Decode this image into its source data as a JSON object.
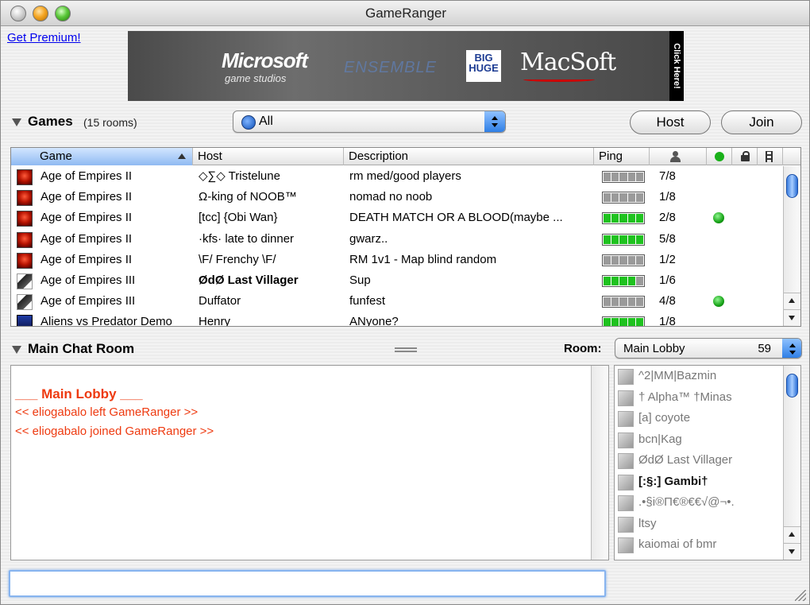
{
  "window": {
    "title": "GameRanger"
  },
  "premium_link": "Get Premium!",
  "banner": {
    "microsoft": "Microsoft",
    "microsoft_sub": "game studios",
    "ensemble": "ENSEMBLE",
    "bighuge": "BIG HUGE",
    "macsoft": "MacSoft",
    "click_here": "Click Here!"
  },
  "games": {
    "label": "Games",
    "count": "(15 rooms)",
    "filter_value": "All",
    "host_label": "Host",
    "join_label": "Join",
    "columns": [
      "Game",
      "Host",
      "Description",
      "Ping"
    ],
    "rows": [
      {
        "icon": "aoe2-icon",
        "game": "Age of Empires II",
        "host": "◇∑◇ Tristelune",
        "host_bold": false,
        "desc": "rm med/good players",
        "ping": 0,
        "players": "7/8",
        "open": false
      },
      {
        "icon": "aoe2-icon",
        "game": "Age of Empires II",
        "host": "Ω-king of NOOB™",
        "host_bold": false,
        "desc": "nomad no noob",
        "ping": 0,
        "players": "1/8",
        "open": false
      },
      {
        "icon": "aoe2-icon",
        "game": "Age of Empires II",
        "host": "[tcc] {Obi Wan}",
        "host_bold": false,
        "desc": "DEATH MATCH OR A BLOOD(maybe ...",
        "ping": 5,
        "players": "2/8",
        "open": true
      },
      {
        "icon": "aoe2-icon",
        "game": "Age of Empires II",
        "host": "·kfs· late to dinner",
        "host_bold": false,
        "desc": "gwarz..",
        "ping": 5,
        "players": "5/8",
        "open": false
      },
      {
        "icon": "aoe2-icon",
        "game": "Age of Empires II",
        "host": "\\F/ Frenchy \\F/",
        "host_bold": false,
        "desc": "RM 1v1 - Map blind random",
        "ping": 0,
        "players": "1/2",
        "open": false
      },
      {
        "icon": "aoe3-icon",
        "game": "Age of Empires III",
        "host": "ØdØ Last Villager",
        "host_bold": true,
        "desc": "Sup",
        "ping": 4,
        "players": "1/6",
        "open": false
      },
      {
        "icon": "aoe3-icon",
        "game": "Age of Empires III",
        "host": "Duffator",
        "host_bold": false,
        "desc": "funfest",
        "ping": 0,
        "players": "4/8",
        "open": true
      },
      {
        "icon": "avp-icon",
        "game": "Aliens vs Predator Demo",
        "host": "Henry",
        "host_bold": false,
        "desc": "ANyone?",
        "ping": 5,
        "players": "1/8",
        "open": false
      }
    ]
  },
  "chat": {
    "label": "Main Chat Room",
    "room_label": "Room:",
    "room_value": "Main Lobby",
    "room_count": "59",
    "lines": [
      {
        "text": "___ Main Lobby ___",
        "title": true
      },
      {
        "text": "<< eliogabalo left GameRanger >>",
        "title": false
      },
      {
        "text": "<< eliogabalo joined GameRanger >>",
        "title": false
      }
    ],
    "input_value": ""
  },
  "users": [
    {
      "name": "^2|MM|Bazmin",
      "bold": false
    },
    {
      "name": "† Alpha™ †Minas",
      "bold": false
    },
    {
      "name": "[a] coyote",
      "bold": false
    },
    {
      "name": "bcn|Kag",
      "bold": false
    },
    {
      "name": "ØdØ Last Villager",
      "bold": false
    },
    {
      "name": "[:§:] Gambi†",
      "bold": true
    },
    {
      "name": ".•§i®Π€®€€√@¬•.",
      "bold": false
    },
    {
      "name": "ltsy",
      "bold": false
    },
    {
      "name": "kaiomai of bmr",
      "bold": false
    }
  ]
}
